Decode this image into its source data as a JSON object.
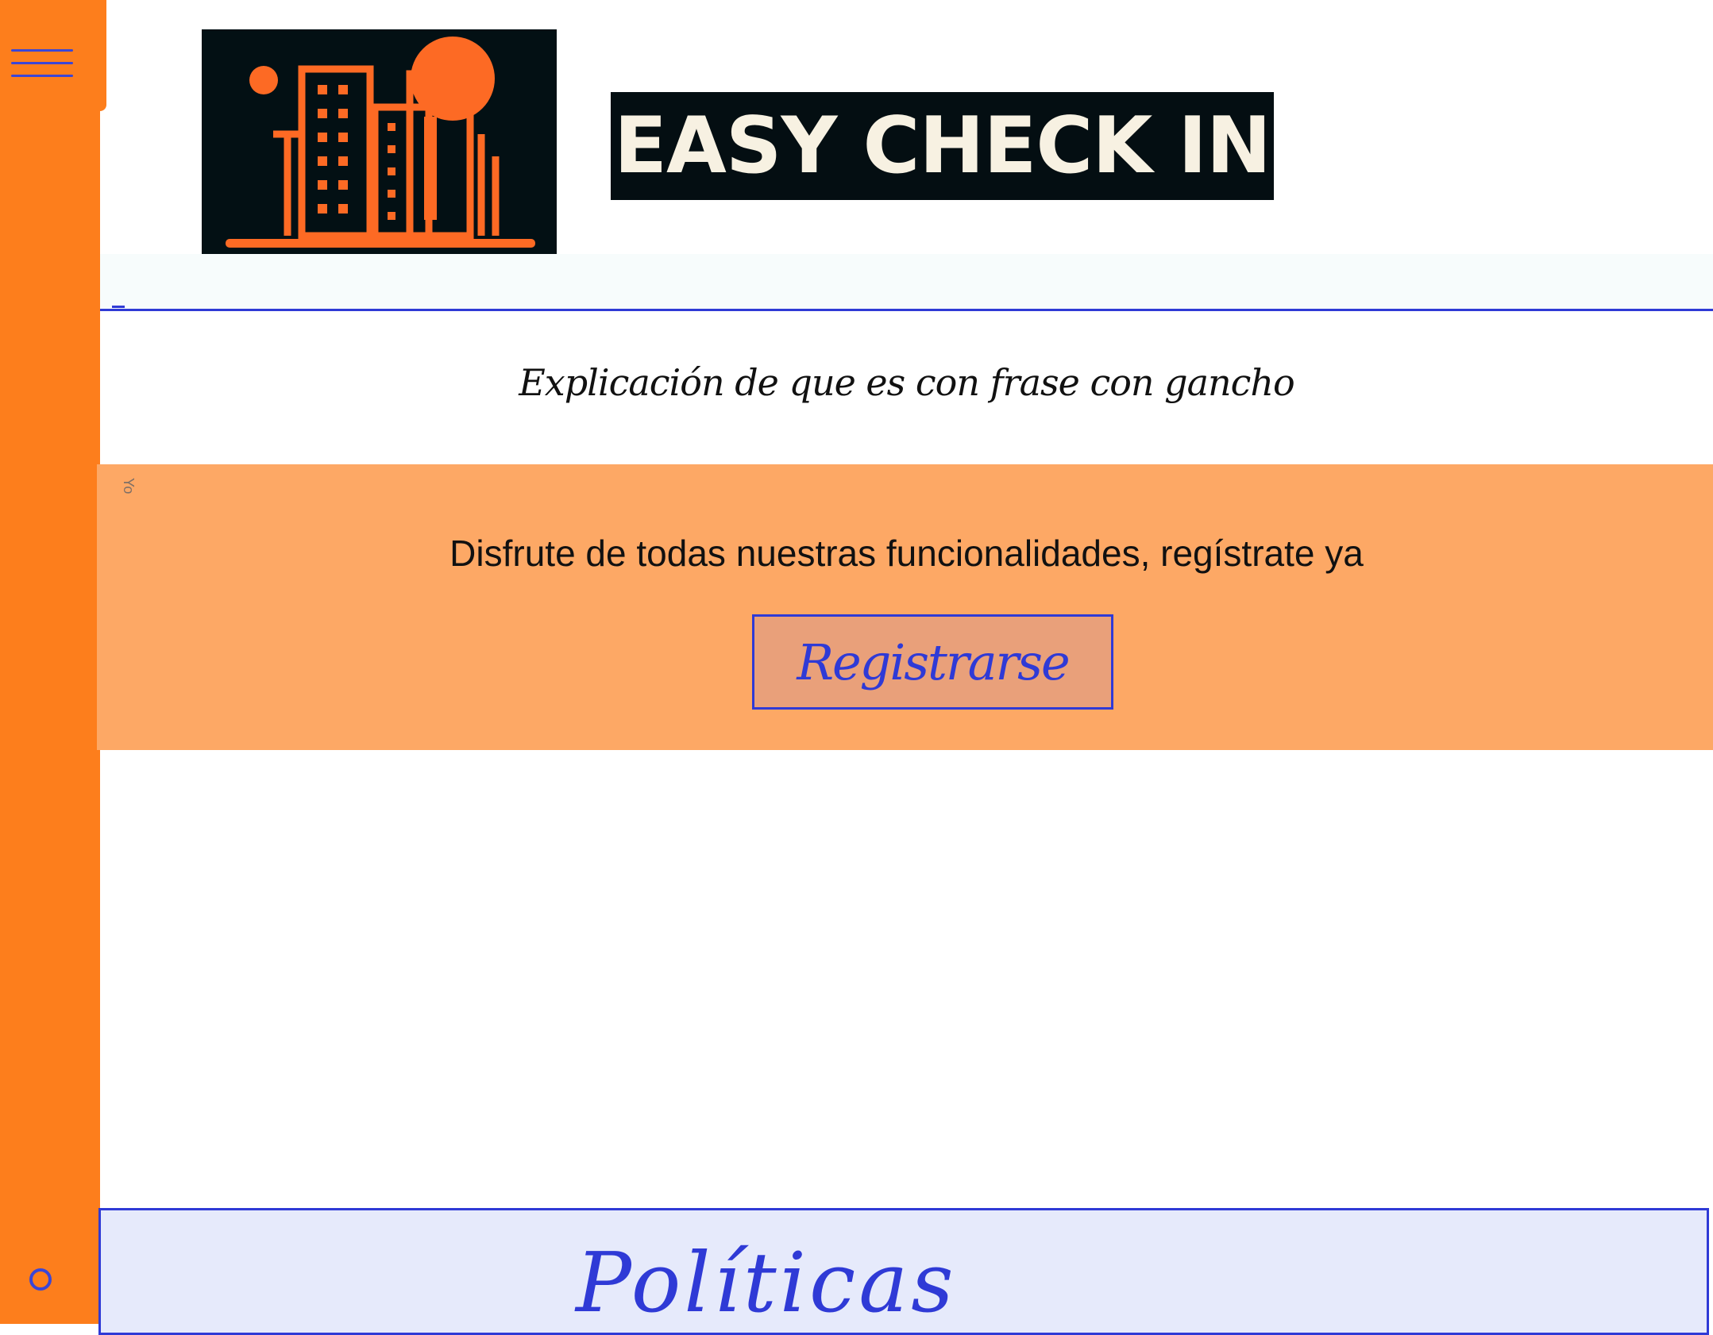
{
  "brand": {
    "name": "EASY CHECK IN",
    "logo_icon": "hotel-building-logo",
    "colors": {
      "orange": "#fd7e1c",
      "dark": "#031014",
      "cream": "#f7f1e2"
    }
  },
  "sidebar": {
    "menu_icon": "hamburger-menu-icon",
    "bottom_icon": "circle-icon"
  },
  "hero": {
    "tagline": "Explicación de que es con frase con gancho"
  },
  "promo": {
    "side_label": "Yo",
    "message": "Disfrute de todas nuestras funcionalidades, regístrate ya",
    "register_label": "Registrarse",
    "background": "#fda865"
  },
  "footer": {
    "link_label": "Políticas"
  },
  "accent_color": "#2f3ad6"
}
